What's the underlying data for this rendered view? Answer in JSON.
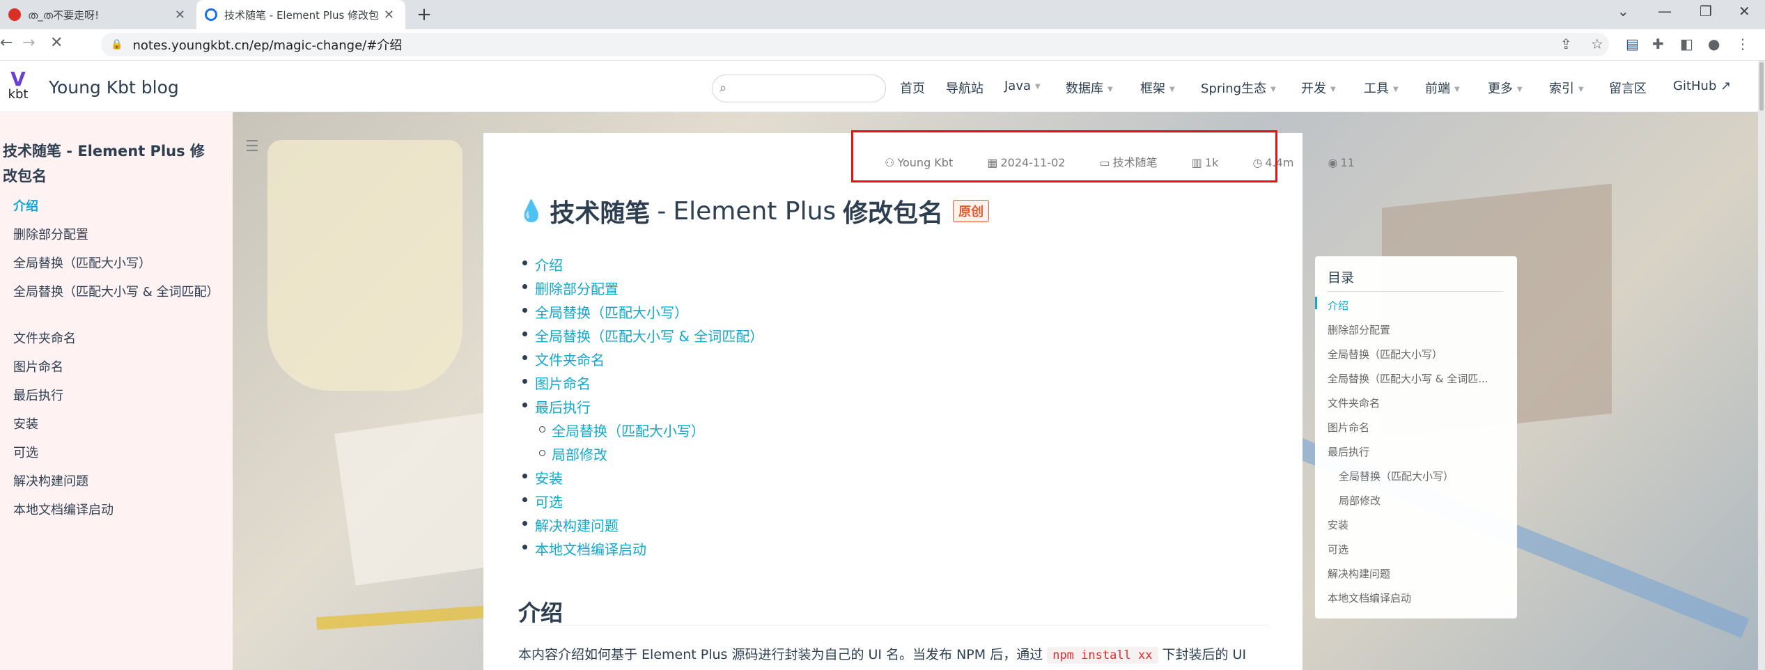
{
  "browser": {
    "tabs": [
      {
        "title": "ത_ത不要走呀!",
        "active": false
      },
      {
        "title": "技术随笔 - Element Plus 修改包",
        "active": true
      }
    ],
    "url": "notes.youngkbt.cn/ep/magic-change/#介绍",
    "window_controls": {
      "dropdown": "⌄",
      "minimize": "—",
      "restore": "❐",
      "close": "✕"
    }
  },
  "site": {
    "logo_mark": "V",
    "logo_text": "kbt",
    "name": "Young Kbt blog",
    "search_placeholder": "",
    "nav": [
      {
        "label": "首页",
        "dropdown": false
      },
      {
        "label": "导航站",
        "dropdown": false
      },
      {
        "label": "Java",
        "dropdown": true
      },
      {
        "label": "数据库",
        "dropdown": true
      },
      {
        "label": "框架",
        "dropdown": true
      },
      {
        "label": "Spring生态",
        "dropdown": true
      },
      {
        "label": "开发",
        "dropdown": true
      },
      {
        "label": "工具",
        "dropdown": true
      },
      {
        "label": "前端",
        "dropdown": true
      },
      {
        "label": "更多",
        "dropdown": true
      },
      {
        "label": "索引",
        "dropdown": true
      },
      {
        "label": "留言区",
        "dropdown": false
      },
      {
        "label": "GitHub ↗",
        "dropdown": false
      }
    ]
  },
  "sidebar": {
    "title": "技术随笔 - Element Plus 修改包名",
    "items": [
      {
        "label": "介绍",
        "active": true
      },
      {
        "label": "删除部分配置",
        "active": false
      },
      {
        "label": "全局替换（匹配大小写）",
        "active": false
      },
      {
        "label": "全局替换（匹配大小写 & 全词匹配）",
        "active": false
      },
      {
        "label": "文件夹命名",
        "active": false
      },
      {
        "label": "图片命名",
        "active": false
      },
      {
        "label": "最后执行",
        "active": false
      },
      {
        "label": "安装",
        "active": false
      },
      {
        "label": "可选",
        "active": false
      },
      {
        "label": "解决构建问题",
        "active": false
      },
      {
        "label": "本地文档编译启动",
        "active": false
      }
    ]
  },
  "article": {
    "meta": {
      "author": "Young Kbt",
      "date": "2024-11-02",
      "category": "技术随笔",
      "words": "1k",
      "read_time": "4.4m",
      "views": "11"
    },
    "title_prefix": "技术随笔",
    "title_sep": "-",
    "title_main": "Element Plus",
    "title_suffix": "修改包名",
    "badge": "原创",
    "toc": [
      {
        "label": "介绍",
        "level": 1
      },
      {
        "label": "删除部分配置",
        "level": 1
      },
      {
        "label": "全局替换（匹配大小写）",
        "level": 1
      },
      {
        "label": "全局替换（匹配大小写 & 全词匹配）",
        "level": 1
      },
      {
        "label": "文件夹命名",
        "level": 1
      },
      {
        "label": "图片命名",
        "level": 1
      },
      {
        "label": "最后执行",
        "level": 1
      },
      {
        "label": "全局替换（匹配大小写）",
        "level": 2
      },
      {
        "label": "局部修改",
        "level": 2
      },
      {
        "label": "安装",
        "level": 1
      },
      {
        "label": "可选",
        "level": 1
      },
      {
        "label": "解决构建问题",
        "level": 1
      },
      {
        "label": "本地文档编译启动",
        "level": 1
      }
    ],
    "section_heading": "介绍",
    "para_before": "本内容介绍如何基于 Element Plus 源码进行封装为自己的 UI 名。当发布 NPM 后，通过",
    "para_code": "npm install xx",
    "para_after": "下封装后的 UI"
  },
  "right_toc": {
    "title": "目录",
    "items": [
      {
        "label": "介绍",
        "level": 1,
        "active": true
      },
      {
        "label": "删除部分配置",
        "level": 1,
        "active": false
      },
      {
        "label": "全局替换（匹配大小写）",
        "level": 1,
        "active": false
      },
      {
        "label": "全局替换（匹配大小写 & 全词匹...",
        "level": 1,
        "active": false
      },
      {
        "label": "文件夹命名",
        "level": 1,
        "active": false
      },
      {
        "label": "图片命名",
        "level": 1,
        "active": false
      },
      {
        "label": "最后执行",
        "level": 1,
        "active": false
      },
      {
        "label": "全局替换（匹配大小写）",
        "level": 2,
        "active": false
      },
      {
        "label": "局部修改",
        "level": 2,
        "active": false
      },
      {
        "label": "安装",
        "level": 1,
        "active": false
      },
      {
        "label": "可选",
        "level": 1,
        "active": false
      },
      {
        "label": "解决构建问题",
        "level": 1,
        "active": false
      },
      {
        "label": "本地文档编译启动",
        "level": 1,
        "active": false
      }
    ]
  },
  "colors": {
    "accent": "#11a8cd",
    "highlight_box": "#e01515",
    "badge": "#e6592f"
  }
}
